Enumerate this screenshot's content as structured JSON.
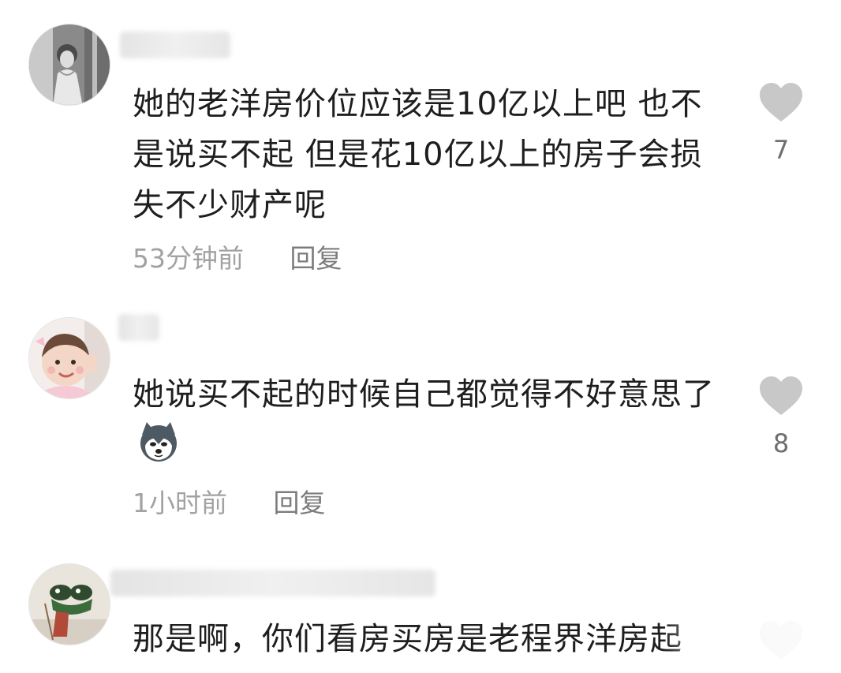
{
  "comments": [
    {
      "text": "她的老洋房价位应该是10亿以上吧 也不是说买不起 但是花10亿以上的房子会损失不少财产呢",
      "time": "53分钟前",
      "reply": "回复",
      "likes": "7"
    },
    {
      "text": "她说买不起的时候自己都觉得不好意思了",
      "emoji": "husky-dog-emoji",
      "time": "1小时前",
      "reply": "回复",
      "likes": "8"
    },
    {
      "text": "那是啊，你们看房买房是老程界洋房起"
    }
  ],
  "colors": {
    "text": "#1e1e1e",
    "meta": "#a2a2a2",
    "reply": "#7c7c7c",
    "heart": "#c8c8c8",
    "like_count": "#6e6e6e"
  },
  "icons": {
    "like": "heart-icon"
  }
}
